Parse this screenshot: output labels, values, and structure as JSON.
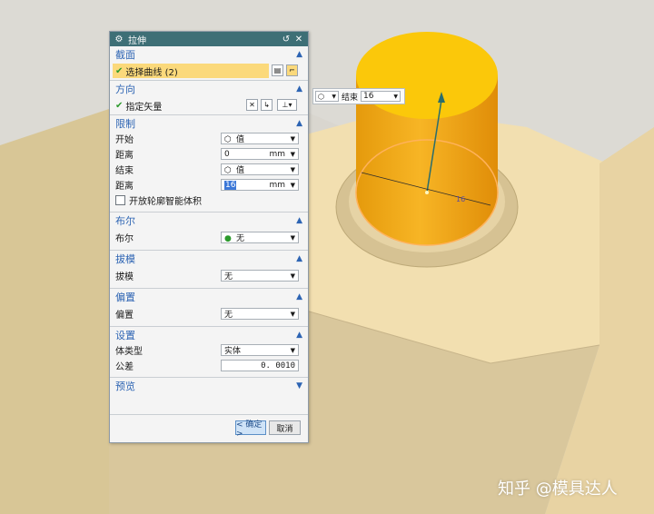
{
  "colors": {
    "accent": "#2d64b3",
    "titlebar": "#3e6f76",
    "selection_highlight": "#fbd97b",
    "cylinder": "#f7c21d",
    "part": "#f0d9a6",
    "check": "#2c9a2c",
    "vector": "#2a6d6d"
  },
  "dialog": {
    "title": "拉伸",
    "icons": [
      "gear-icon",
      "reset-icon",
      "close-icon"
    ],
    "sections": {
      "section": {
        "title": "截面",
        "select_curve": "选择曲线 (2)"
      },
      "direction": {
        "title": "方向",
        "specify_vector": "指定矢量"
      },
      "limits": {
        "title": "限制",
        "start_label": "开始",
        "start_value": "值",
        "start_distance_label": "距离",
        "start_distance_value": "0",
        "end_label": "结束",
        "end_value": "值",
        "end_distance_label": "距离",
        "end_distance_value": "16",
        "unit": "mm",
        "open_profile_label": "开放轮廓智能体积"
      },
      "boolean": {
        "title": "布尔",
        "label": "布尔",
        "value": "无"
      },
      "draft": {
        "title": "拔模",
        "label": "拔模",
        "value": "无"
      },
      "offset": {
        "title": "偏置",
        "label": "偏置",
        "value": "无"
      },
      "settings": {
        "title": "设置",
        "body_type_label": "体类型",
        "body_type_value": "实体",
        "tolerance_label": "公差",
        "tolerance_value": "0. 0010"
      },
      "preview": {
        "title": "预览"
      }
    },
    "ok_button": "< 确定 >",
    "cancel_button": "取消"
  },
  "float_control": {
    "label": "结束",
    "value": "16"
  },
  "viewport": {
    "dimension_label": "16"
  },
  "watermark": "知乎 @模具达人"
}
